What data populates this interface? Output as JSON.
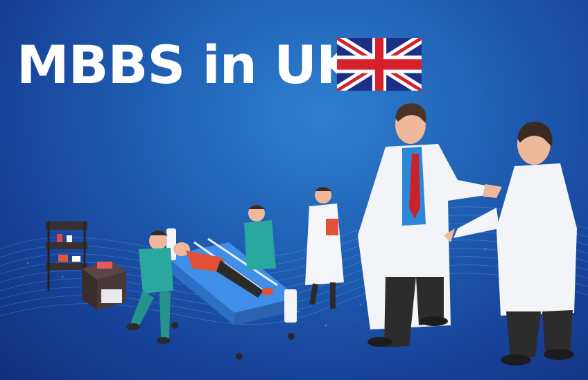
{
  "banner": {
    "title": "MBBS in UK",
    "flag_icon": "uk-flag-icon",
    "colors": {
      "background": "#1f5fb3",
      "title": "#ffffff",
      "flag_blue": "#1b2f87",
      "flag_red": "#d6202b"
    }
  }
}
